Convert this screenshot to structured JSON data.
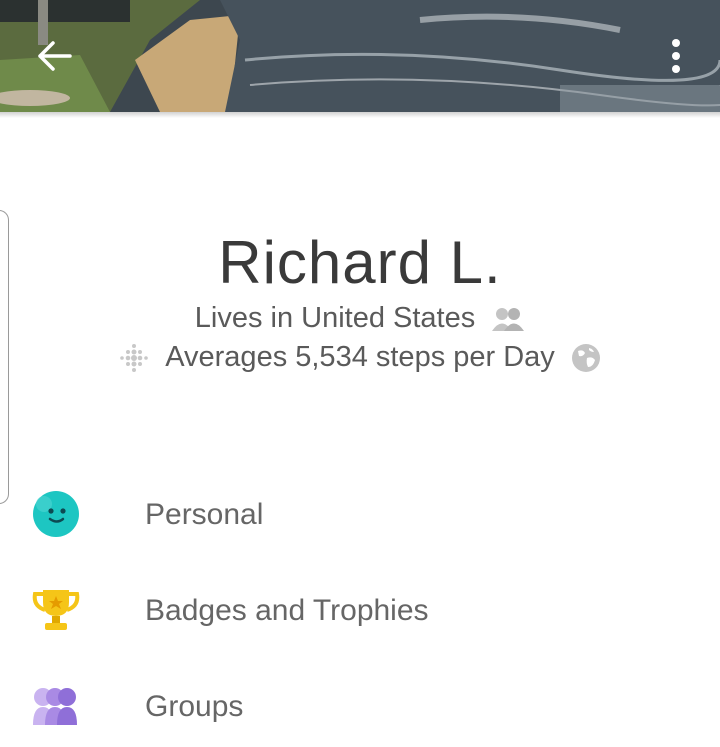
{
  "header": {
    "back_icon": "arrow-left-icon",
    "more_icon": "more-vertical-icon"
  },
  "profile": {
    "name": "Richard L.",
    "location": "Lives in United States",
    "location_privacy_icon": "friends-icon",
    "steps": "Averages 5,534 steps per Day",
    "steps_icon": "fitbit-dots-icon",
    "steps_privacy_icon": "globe-icon"
  },
  "menu": {
    "items": [
      {
        "label": "Personal",
        "icon": "smiley-face-icon",
        "color": "#1dc6c2"
      },
      {
        "label": "Badges and Trophies",
        "icon": "trophy-icon",
        "color": "#f5c518"
      },
      {
        "label": "Groups",
        "icon": "groups-icon",
        "color": "#8f6fd8"
      }
    ]
  }
}
